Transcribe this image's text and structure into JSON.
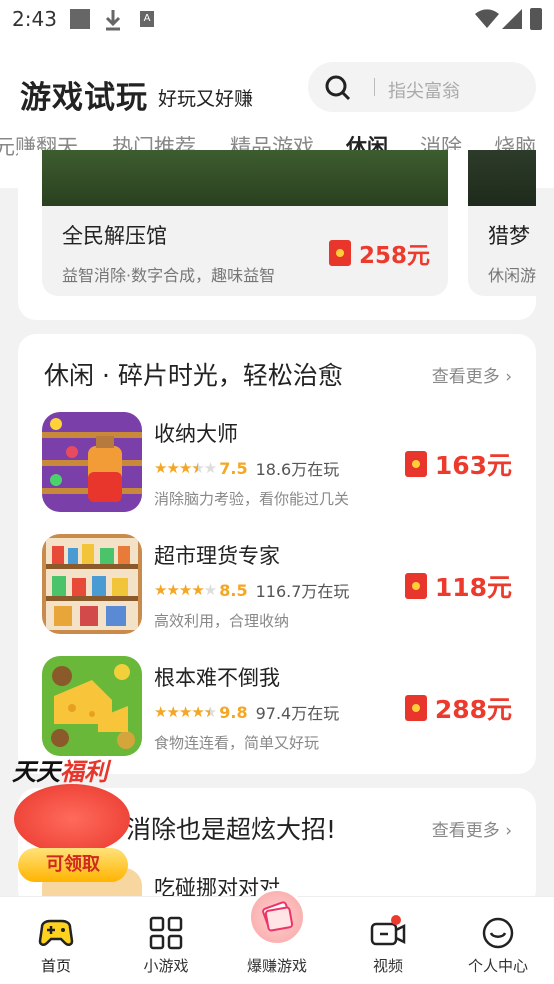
{
  "status_bar": {
    "time": "2:43",
    "icons": [
      "square-icon",
      "download-icon",
      "a-badge-icon",
      "wifi-icon",
      "signal-icon",
      "battery-icon"
    ]
  },
  "header": {
    "title": "游戏试玩",
    "subtitle": "好玩又好赚",
    "search_placeholder": "指尖富翁"
  },
  "tabs": [
    {
      "label": "玩赚翻天",
      "display": "元赚翻天",
      "active": false
    },
    {
      "label": "热门推荐",
      "active": false
    },
    {
      "label": "精品游戏",
      "active": false
    },
    {
      "label": "休闲",
      "active": true
    },
    {
      "label": "消除",
      "active": false
    },
    {
      "label": "烧脑",
      "active": false
    }
  ],
  "featured": [
    {
      "name": "全民解压馆",
      "desc": "益智消除·数字合成，趣味益智",
      "price": "258元"
    },
    {
      "name": "猎梦",
      "desc": "休闲游",
      "price": ""
    }
  ],
  "section1": {
    "title": "休闲 · 碎片时光，轻松治愈",
    "more": "查看更多 ›",
    "games": [
      {
        "name": "收纳大师",
        "score": "7.5",
        "rating": 3.5,
        "players": "18.6万在玩",
        "desc": "消除脑力考验，看你能过几关",
        "price": "163元"
      },
      {
        "name": "超市理货专家",
        "score": "8.5",
        "rating": 4,
        "players": "116.7万在玩",
        "desc": "高效利用，合理收纳",
        "price": "118元"
      },
      {
        "name": "根本难不倒我",
        "score": "9.8",
        "rating": 4.5,
        "players": "97.4万在玩",
        "desc": "食物连连看，简单又好玩",
        "price": "288元"
      }
    ]
  },
  "section2": {
    "title": "消除也是超炫大招!",
    "more": "查看更多 ›",
    "first_game": "吃碰挪对对对"
  },
  "welfare": {
    "title_a": "天天",
    "title_b": "福利",
    "button": "可领取"
  },
  "bottom_nav": [
    {
      "label": "首页",
      "icon": "gamepad-icon",
      "active": true
    },
    {
      "label": "小游戏",
      "icon": "grid-icon",
      "active": false
    },
    {
      "label": "爆赚游戏",
      "icon": "money-icon",
      "active": false
    },
    {
      "label": "视频",
      "icon": "video-icon",
      "active": false
    },
    {
      "label": "个人中心",
      "icon": "smile-icon",
      "active": false
    }
  ],
  "colors": {
    "accent": "#ffcc00",
    "price": "#ec3a2d",
    "star": "#f5a623"
  }
}
